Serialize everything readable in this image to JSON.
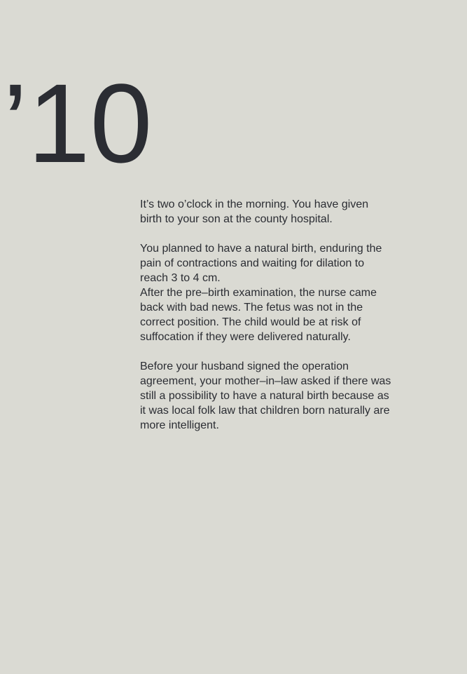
{
  "year": "’10",
  "paragraphs": {
    "p1": "It’s two o’clock in the morning. You have given\nbirth to your son at the county hospital.",
    "p2": "You planned to have a natural birth, enduring the\npain of contractions and waiting for dilation to\nreach 3 to 4 cm.",
    "p3": "After the pre–birth examination, the nurse came\nback with bad news.  The fetus was not in the\ncorrect position. The child would be at risk of\nsuffocation if they were delivered naturally.",
    "p4": "Before your husband signed the operation\nagreement, your mother–in–law asked if there was\nstill a possibility to have a natural birth because as\nit was local folk law that children born naturally are\nmore intelligent."
  }
}
